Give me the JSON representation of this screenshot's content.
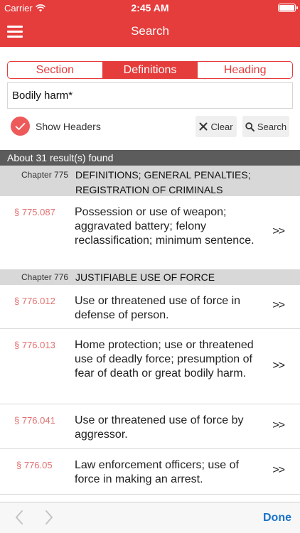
{
  "status": {
    "carrier": "Carrier",
    "time": "2:45 AM"
  },
  "nav": {
    "title": "Search",
    "menu_icon": "hamburger-menu-icon"
  },
  "tabs": [
    {
      "label": "Section",
      "active": false
    },
    {
      "label": "Definitions",
      "active": true
    },
    {
      "label": "Heading",
      "active": false
    }
  ],
  "search": {
    "value": "Bodily harm*"
  },
  "options": {
    "show_headers_label": "Show Headers",
    "show_headers_checked": true
  },
  "buttons": {
    "clear": "Clear",
    "search": "Search"
  },
  "results": {
    "summary": "About 31 result(s) found",
    "groups": [
      {
        "chapter": "Chapter 775",
        "title": "DEFINITIONS; GENERAL PENALTIES; REGISTRATION OF CRIMINALS",
        "items": [
          {
            "section": "§ 775.087",
            "description": "Possession or use of weapon; aggravated battery; felony reclassification; minimum sentence."
          }
        ]
      },
      {
        "chapter": "Chapter 776",
        "title": "JUSTIFIABLE USE OF FORCE",
        "items": [
          {
            "section": "§ 776.012",
            "description": "Use or threatened use of force in defense of person."
          },
          {
            "section": "§ 776.013",
            "description": "Home protection; use or threatened use of deadly force; presumption of fear of death or great bodily harm."
          },
          {
            "section": "§ 776.041",
            "description": "Use or threatened use of force by aggressor."
          },
          {
            "section": "§ 776.05",
            "description": "Law enforcement officers; use of force in making an arrest."
          }
        ]
      }
    ],
    "chevron": ">>"
  },
  "toolbar": {
    "done": "Done"
  },
  "colors": {
    "accent": "#e53c3c",
    "section_number": "#e07070",
    "done_link": "#1a73c9",
    "results_bar": "#5c5c5c",
    "chapter_bar": "#d8d8d8"
  }
}
